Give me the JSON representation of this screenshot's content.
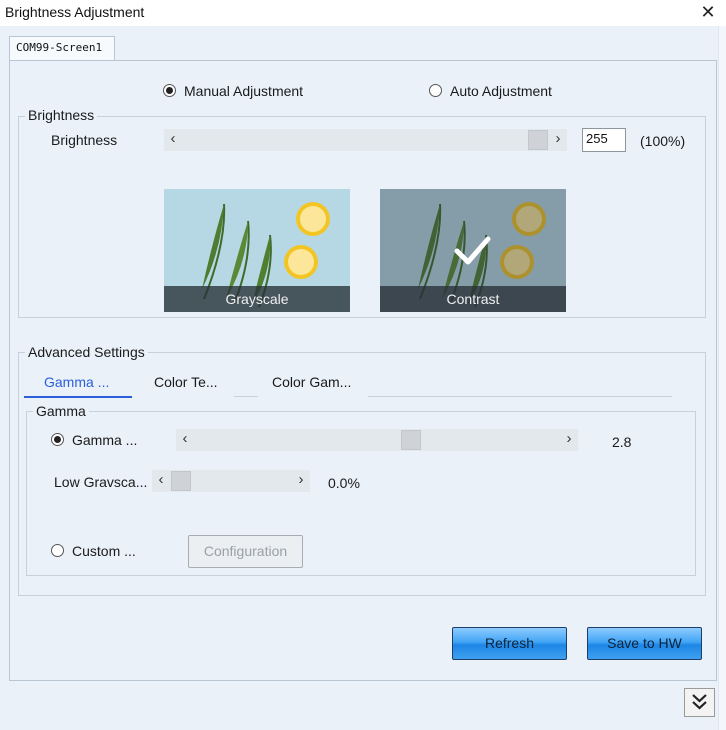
{
  "window": {
    "title": "Brightness Adjustment",
    "close_glyph": "✕"
  },
  "screen_tab": {
    "label": "COM99-Screen1"
  },
  "adjustment_mode": {
    "manual_label": "Manual Adjustment",
    "auto_label": "Auto Adjustment",
    "selected": "manual"
  },
  "brightness": {
    "group_title": "Brightness",
    "label": "Brightness",
    "value": "255",
    "percent": "(100%)",
    "level_fraction": 1.0,
    "left_arrow": "‹",
    "right_arrow": "›"
  },
  "modes": [
    {
      "label": "Grayscale",
      "selected": false
    },
    {
      "label": "Contrast",
      "selected": true
    }
  ],
  "advanced": {
    "group_title": "Advanced Settings",
    "tabs": [
      "Gamma ...",
      "Color Te...",
      "Color Gam..."
    ],
    "active_tab": 0
  },
  "gamma": {
    "group_title": "Gamma",
    "gamma_radio_label": "Gamma ...",
    "gamma_value": "2.8",
    "low_gray_label": "Low Gravsca...",
    "low_gray_value": "0.0%",
    "custom_label": "Custom ...",
    "configuration_label": "Configuration",
    "selected": "gamma"
  },
  "buttons": {
    "refresh": "Refresh",
    "save": "Save to HW"
  },
  "colors": {
    "client_bg": "#eaf1f9",
    "active_tab": "#2b5fd9",
    "button_blue": "#42a5f5"
  },
  "icons": [
    "close-icon",
    "radio-icon",
    "chevron-left-icon",
    "chevron-right-icon",
    "checkmark-icon",
    "double-chevron-down-icon"
  ]
}
